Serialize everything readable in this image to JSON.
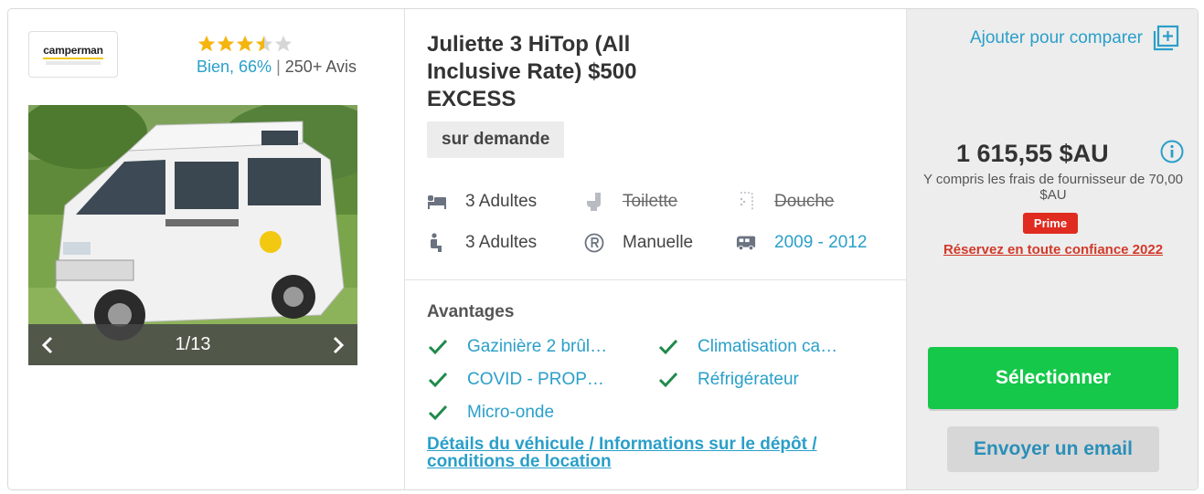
{
  "vendor": {
    "logo_text": "camperman",
    "rating_stars": 3.5,
    "rating_max": 5,
    "rating_word": "Bien, 66%",
    "rating_separator": "|",
    "reviews_count": "250+ Avis"
  },
  "gallery": {
    "counter": "1/13",
    "prev_icon": "chevron-left-icon",
    "next_icon": "chevron-right-icon"
  },
  "vehicle": {
    "title": "Juliette 3 HiTop (All Inclusive Rate) $500 EXCESS",
    "availability": "sur demande",
    "specs": [
      {
        "icon": "bed-icon",
        "label": "3 Adultes",
        "state": "normal"
      },
      {
        "icon": "toilet-icon",
        "label": "Toilette",
        "state": "unavailable"
      },
      {
        "icon": "shower-icon",
        "label": "Douche",
        "state": "unavailable"
      },
      {
        "icon": "seat-icon",
        "label": "3 Adultes",
        "state": "normal"
      },
      {
        "icon": "transmission-icon",
        "label": "Manuelle",
        "state": "normal"
      },
      {
        "icon": "vehicle-icon",
        "label": "2009 - 2012",
        "state": "link"
      }
    ]
  },
  "advantages": {
    "title": "Avantages",
    "items": [
      "Gazinière 2 brûl…",
      "Climatisation ca…",
      "COVID - PROP…",
      "Réfrigérateur",
      "Micro-onde"
    ]
  },
  "details_link": "Détails du véhicule / Informations sur le dépôt / conditions de location",
  "pricing": {
    "compare_label": "Ajouter pour comparer",
    "price": "1 615,55 $AU",
    "fee_note": "Y compris les frais de fournisseur de 70,00 $AU",
    "prime_badge": "Prime",
    "confidence_link": "Réservez en toute confiance 2022",
    "select_label": "Sélectionner",
    "email_label": "Envoyer un email"
  },
  "colors": {
    "accent": "#2a9fc9",
    "select_button": "#15c84a",
    "star": "#f5b50f",
    "prime": "#e02b20",
    "check": "#1f8a4c"
  }
}
